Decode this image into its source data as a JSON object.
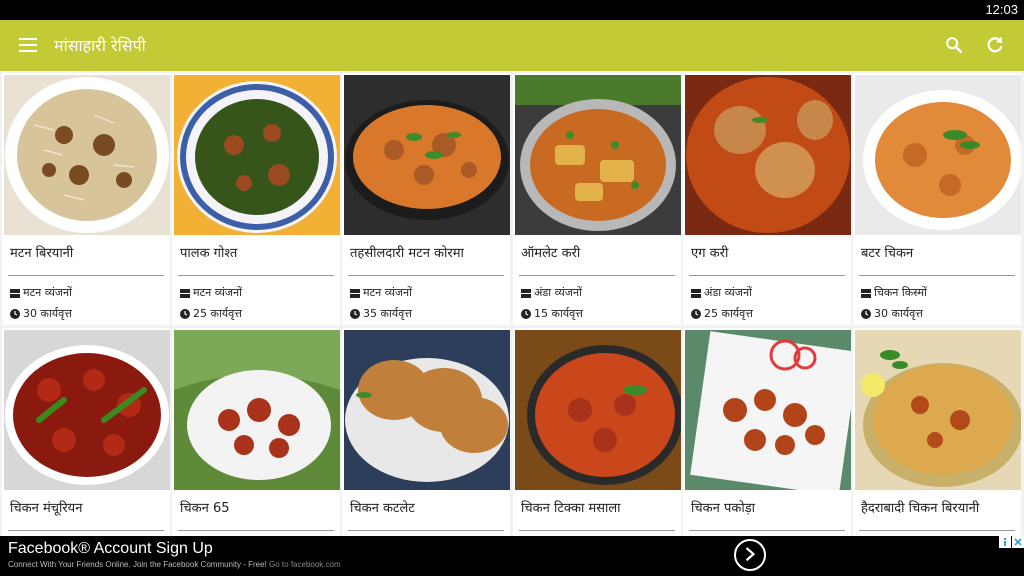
{
  "status": {
    "time": "12:03"
  },
  "appbar": {
    "title": "मांसाहारी रेसिपी",
    "icons": [
      "menu-icon",
      "search-icon",
      "refresh-icon"
    ]
  },
  "colors": {
    "appbar": "#c2cb35",
    "card": "#ffffff",
    "background": "#f2f2f2"
  },
  "recipes": [
    {
      "name": "मटन बिरयानी",
      "category": "मटन व्यंजनों",
      "time": "30 कार्यवृत्त",
      "image": "mutton-biryani"
    },
    {
      "name": "पालक गोश्त",
      "category": "मटन व्यंजनों",
      "time": "25 कार्यवृत्त",
      "image": "palak-gosht"
    },
    {
      "name": "तहसीलदारी मटन कोरमा",
      "category": "मटन व्यंजनों",
      "time": "35 कार्यवृत्त",
      "image": "mutton-korma"
    },
    {
      "name": "ऑमलेट करी",
      "category": "अंडा व्यंजनों",
      "time": "15 कार्यवृत्त",
      "image": "omelette-curry"
    },
    {
      "name": "एग करी",
      "category": "अंडा व्यंजनों",
      "time": "25 कार्यवृत्त",
      "image": "egg-curry"
    },
    {
      "name": "बटर चिकन",
      "category": "चिकन किस्मों",
      "time": "30 कार्यवृत्त",
      "image": "butter-chicken"
    },
    {
      "name": "चिकन मंचूरियन",
      "image": "chicken-manchurian"
    },
    {
      "name": "चिकन 65",
      "image": "chicken-65"
    },
    {
      "name": "चिकन कटलेट",
      "image": "chicken-cutlet"
    },
    {
      "name": "चिकन टिक्का मसाला",
      "image": "chicken-tikka-masala"
    },
    {
      "name": "चिकन पकोड़ा",
      "image": "chicken-pakora"
    },
    {
      "name": "हैदराबादी चिकन बिरयानी",
      "image": "hyderabadi-chicken-biryani"
    }
  ],
  "ad": {
    "headline": "Facebook® Account Sign Up",
    "text": "Connect With Your Friends Online. Join the Facebook Community - Free!",
    "link": "Go to facebook.com"
  }
}
